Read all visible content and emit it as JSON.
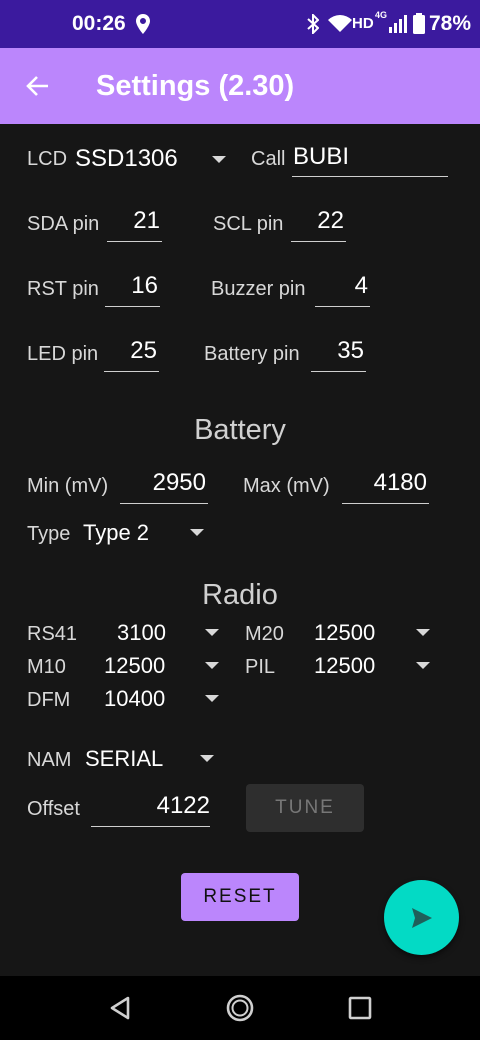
{
  "status_bar": {
    "time": "00:26",
    "net": "HD",
    "net_sup": "4G",
    "battery": "78%"
  },
  "app_bar": {
    "title": "Settings (2.30)"
  },
  "lcd": {
    "label": "LCD",
    "value": "SSD1306"
  },
  "call": {
    "label": "Call",
    "value": "BUBI"
  },
  "pins": {
    "sda": {
      "label": "SDA pin",
      "value": "21"
    },
    "scl": {
      "label": "SCL pin",
      "value": "22"
    },
    "rst": {
      "label": "RST pin",
      "value": "16"
    },
    "buzzer": {
      "label": "Buzzer pin",
      "value": "4"
    },
    "led": {
      "label": "LED pin",
      "value": "25"
    },
    "battery": {
      "label": "Battery pin",
      "value": "35"
    }
  },
  "battery_section": {
    "title": "Battery",
    "min": {
      "label": "Min (mV)",
      "value": "2950"
    },
    "max": {
      "label": "Max (mV)",
      "value": "4180"
    },
    "type": {
      "label": "Type",
      "value": "Type 2"
    }
  },
  "radio_section": {
    "title": "Radio",
    "rs41": {
      "label": "RS41",
      "value": "3100"
    },
    "m20": {
      "label": "M20",
      "value": "12500"
    },
    "m10": {
      "label": "M10",
      "value": "12500"
    },
    "pil": {
      "label": "PIL",
      "value": "12500"
    },
    "dfm": {
      "label": "DFM",
      "value": "10400"
    },
    "nam": {
      "label": "NAM",
      "value": "SERIAL"
    },
    "offset": {
      "label": "Offset",
      "value": "4122"
    },
    "tune_label": "TUNE"
  },
  "reset_label": "RESET",
  "colors": {
    "status_bar": "#3b1a9e",
    "app_bar": "#bb86fc",
    "fab": "#03dac5",
    "background": "#161616"
  },
  "icons": [
    "location-icon",
    "bluetooth-icon",
    "wifi-icon",
    "signal-icon",
    "battery-icon",
    "back-arrow-icon",
    "send-icon",
    "nav-back-icon",
    "nav-home-icon",
    "nav-recents-icon"
  ]
}
